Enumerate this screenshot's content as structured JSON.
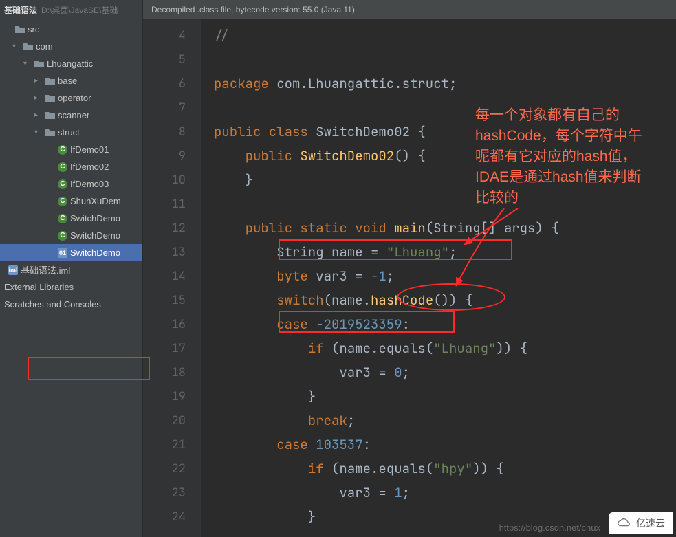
{
  "breadcrumb": {
    "project": "基础语法",
    "path": "D:\\桌面\\JavaSE\\基础"
  },
  "tree": {
    "src": "src",
    "com": "com",
    "pkg": "Lhuangattic",
    "base": "base",
    "operator": "operator",
    "scanner": "scanner",
    "struct": "struct",
    "files": {
      "ifdemo01": "IfDemo01",
      "ifdemo02": "IfDemo02",
      "ifdemo03": "IfDemo03",
      "shunxu": "ShunXuDem",
      "switch1": "SwitchDemo",
      "switch2": "SwitchDemo",
      "switch3": "SwitchDemo"
    },
    "iml": "基础语法.iml",
    "external": "External Libraries",
    "scratch": "Scratches and Consoles"
  },
  "banner": "Decompiled .class file, bytecode version: 55.0 (Java 11)",
  "gutter": [
    "4",
    "5",
    "6",
    "7",
    "8",
    "9",
    "10",
    "11",
    "12",
    "13",
    "14",
    "15",
    "16",
    "17",
    "18",
    "19",
    "20",
    "21",
    "22",
    "23",
    "24"
  ],
  "code": {
    "l4": "//",
    "l5": "",
    "l6a": "package ",
    "l6b": "com.Lhuangattic.struct;",
    "l7": "",
    "l8a": "public class ",
    "l8b": "SwitchDemo02 {",
    "l9a": "    public ",
    "l9b": "SwitchDemo02",
    "l9c": "() {",
    "l10": "    }",
    "l11": "",
    "l12a": "    public static void ",
    "l12b": "main",
    "l12c": "(String[] args) {",
    "l13a": "        String name = ",
    "l13b": "\"Lhuang\"",
    "l13c": ";",
    "l14a": "        byte ",
    "l14b": "var3 = ",
    "l14c": "-1",
    "l14d": ";",
    "l15a": "        switch",
    "l15b": "(name.",
    "l15c": "hashCode",
    "l15d": "()) {",
    "l16a": "        case ",
    "l16b": "-2019523359",
    "l16c": ":",
    "l17a": "            if ",
    "l17b": "(name.equals(",
    "l17c": "\"Lhuang\"",
    "l17d": ")) {",
    "l18a": "                var3 = ",
    "l18b": "0",
    "l18c": ";",
    "l19": "            }",
    "l20a": "            break",
    "l20b": ";",
    "l21a": "        case ",
    "l21b": "103537",
    "l21c": ":",
    "l22a": "            if ",
    "l22b": "(name.equals(",
    "l22c": "\"hpy\"",
    "l22d": ")) {",
    "l23a": "                var3 = ",
    "l23b": "1",
    "l23c": ";",
    "l24": "            }"
  },
  "annotation": {
    "t1": "每一个对象都有自己的",
    "t2": "hashCode，每个字符中午",
    "t3": "呢都有它对应的hash值，",
    "t4": "IDAE是通过hash值来判断",
    "t5": "比较的"
  },
  "watermark": "https://blog.csdn.net/chux",
  "badge": "亿速云"
}
